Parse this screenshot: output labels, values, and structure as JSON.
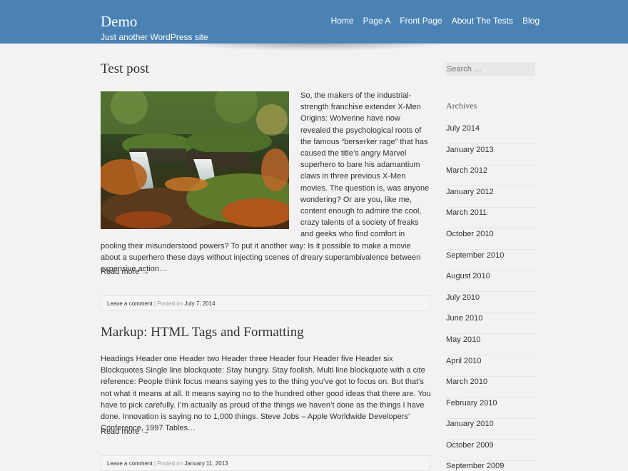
{
  "site": {
    "title": "Demo",
    "description": "Just another WordPress site"
  },
  "nav": [
    "Home",
    "Page A",
    "Front Page",
    "About The Tests",
    "Blog"
  ],
  "posts": [
    {
      "title": "Test post",
      "excerpt": "So, the makers of the industrial-strength franchise extender X-Men Origins: Wolverine have now revealed the psychological roots of the famous “berserker rage” that has caused the title’s angry Marvel superhero to bare his adamantium claws in three previous X-Men movies. The question is, was anyone wondering? Or are you, like me, content enough to admire the cool, crazy talents of a society of freaks and geeks who find comfort in pooling their misunderstood powers? To put it another way: Is it possible to make a movie about a superhero these days without injecting scenes of dreary superambivalence between expensive action…",
      "read_more": "Read more →",
      "meta": {
        "comment": "Leave a comment",
        "sep": " | Posted on ",
        "date": "July 7, 2014"
      }
    },
    {
      "title": "Markup: HTML Tags and Formatting",
      "excerpt": "Headings Header one Header two Header three Header four Header five Header six Blockquotes Single line blockquote: Stay hungry. Stay foolish. Multi line blockquote with a cite reference: People think focus means saying yes to the thing you’ve got to focus on. But that’s not what it means at all. It means saying no to the hundred other good ideas that there are. You have to pick carefully. I’m actually as proud of the things we haven’t done as the things I have done. Innovation is saying no to 1,000 things. Steve Jobs – Apple Worldwide Developers’ Conference, 1997 Tables…",
      "read_more": "Read more →",
      "meta": {
        "comment": "Leave a comment",
        "sep": " | Posted on ",
        "date": "January 11, 2013"
      }
    }
  ],
  "sidebar": {
    "search_placeholder": "Search …",
    "archives_title": "Archives",
    "archives": [
      "July 2014",
      "January 2013",
      "March 2012",
      "January 2012",
      "March 2011",
      "October 2010",
      "September 2010",
      "August 2010",
      "July 2010",
      "June 2010",
      "May 2010",
      "April 2010",
      "March 2010",
      "February 2010",
      "January 2010",
      "October 2009",
      "September 2009"
    ]
  },
  "colors": {
    "header": "#4a82b4",
    "background": "#f2f2f2"
  }
}
